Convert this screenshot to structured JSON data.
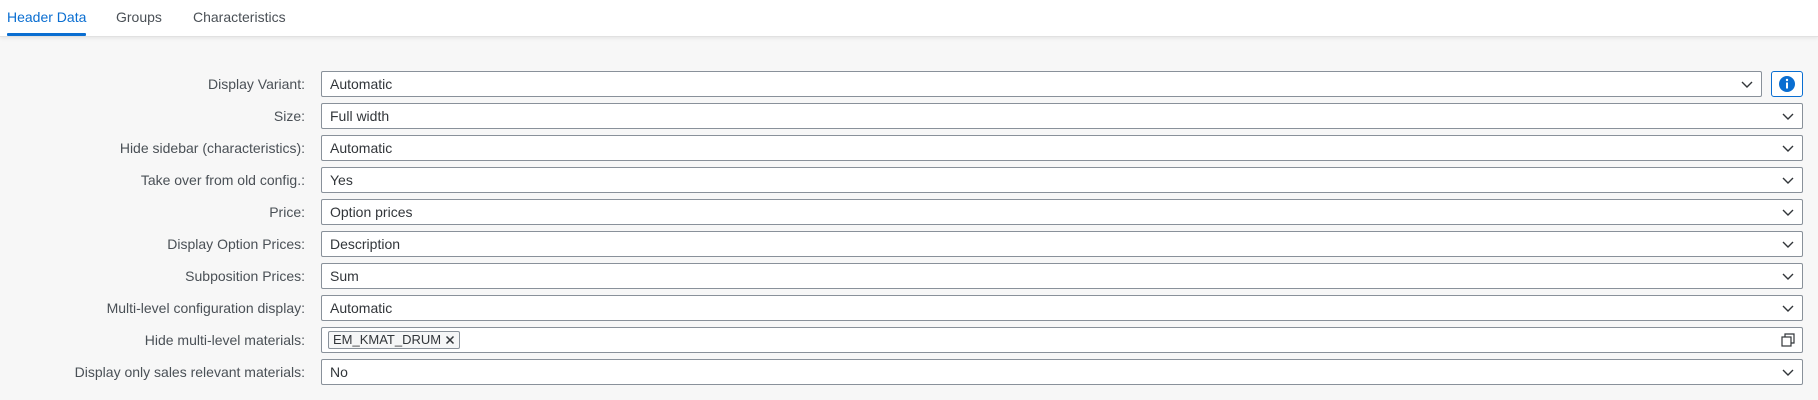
{
  "tabs": [
    {
      "label": "Header Data",
      "active": true
    },
    {
      "label": "Groups",
      "active": false
    },
    {
      "label": "Characteristics",
      "active": false
    }
  ],
  "form": {
    "display_variant": {
      "label": "Display Variant:",
      "value": "Automatic"
    },
    "size": {
      "label": "Size:",
      "value": "Full width"
    },
    "hide_sidebar": {
      "label": "Hide sidebar (characteristics):",
      "value": "Automatic"
    },
    "take_over": {
      "label": "Take over from old config.:",
      "value": "Yes"
    },
    "price": {
      "label": "Price:",
      "value": "Option prices"
    },
    "display_option_prices": {
      "label": "Display Option Prices:",
      "value": "Description"
    },
    "subposition_prices": {
      "label": "Subposition Prices:",
      "value": "Sum"
    },
    "multilevel_display": {
      "label": "Multi-level configuration display:",
      "value": "Automatic"
    },
    "hide_multilevel_materials": {
      "label": "Hide multi-level materials:",
      "tokens": [
        "EM_KMAT_DRUM"
      ]
    },
    "sales_relevant_only": {
      "label": "Display only sales relevant materials:",
      "value": "No"
    }
  },
  "icons": {
    "chevron": "chevron-down-icon",
    "info": "info-icon",
    "value_help": "value-help-icon",
    "token_remove": "close-icon"
  },
  "colors": {
    "accent": "#0a6ed1",
    "border": "#89919a",
    "background": "#f7f7f7",
    "text": "#32363a"
  }
}
